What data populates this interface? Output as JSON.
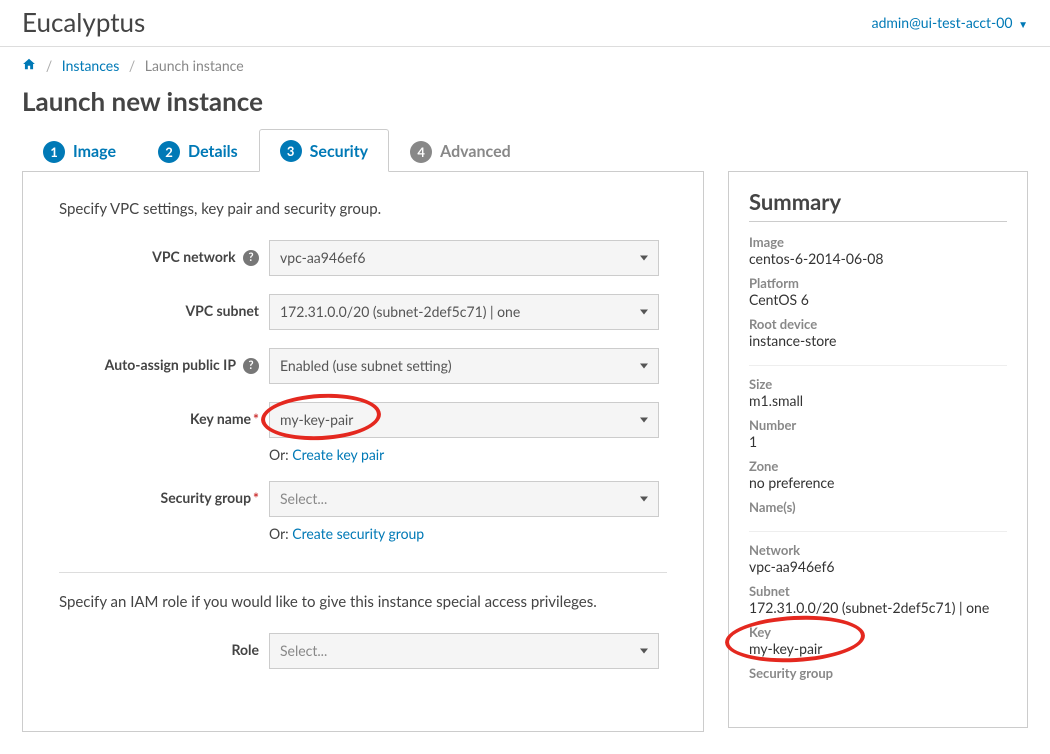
{
  "header": {
    "brand": "Eucalyptus",
    "account": "admin@ui-test-acct-00"
  },
  "breadcrumb": {
    "home_icon": "home-icon",
    "items": [
      "Instances",
      "Launch instance"
    ]
  },
  "page_title": "Launch new instance",
  "tabs": [
    {
      "num": "1",
      "label": "Image",
      "active": false,
      "done": true
    },
    {
      "num": "2",
      "label": "Details",
      "active": false,
      "done": true
    },
    {
      "num": "3",
      "label": "Security",
      "active": true,
      "done": false
    },
    {
      "num": "4",
      "label": "Advanced",
      "active": false,
      "done": false
    }
  ],
  "form": {
    "intro1": "Specify VPC settings, key pair and security group.",
    "rows": {
      "vpc_network": {
        "label": "VPC network",
        "value": "vpc-aa946ef6",
        "help": true
      },
      "vpc_subnet": {
        "label": "VPC subnet",
        "value": "172.31.0.0/20 (subnet-2def5c71) | one"
      },
      "auto_ip": {
        "label": "Auto-assign public IP",
        "value": "Enabled (use subnet setting)",
        "help": true
      },
      "key_name": {
        "label": "Key name",
        "value": "my-key-pair",
        "required": true,
        "or_text": "Or:",
        "or_link": "Create key pair"
      },
      "sec_group": {
        "label": "Security group",
        "placeholder": "Select...",
        "required": true,
        "or_text": "Or:",
        "or_link": "Create security group"
      },
      "role": {
        "label": "Role",
        "placeholder": "Select..."
      }
    },
    "intro2": "Specify an IAM role if you would like to give this instance special access privileges."
  },
  "summary": {
    "title": "Summary",
    "groups": [
      [
        {
          "label": "Image",
          "value": "centos-6-2014-06-08"
        },
        {
          "label": "Platform",
          "value": "CentOS 6"
        },
        {
          "label": "Root device",
          "value": "instance-store"
        }
      ],
      [
        {
          "label": "Size",
          "value": "m1.small"
        },
        {
          "label": "Number",
          "value": "1"
        },
        {
          "label": "Zone",
          "value": "no preference"
        },
        {
          "label": "Name(s)",
          "value": ""
        }
      ],
      [
        {
          "label": "Network",
          "value": "vpc-aa946ef6"
        },
        {
          "label": "Subnet",
          "value": "172.31.0.0/20 (subnet-2def5c71) | one"
        },
        {
          "label": "Key",
          "value": "my-key-pair"
        },
        {
          "label": "Security group",
          "value": ""
        }
      ]
    ]
  }
}
